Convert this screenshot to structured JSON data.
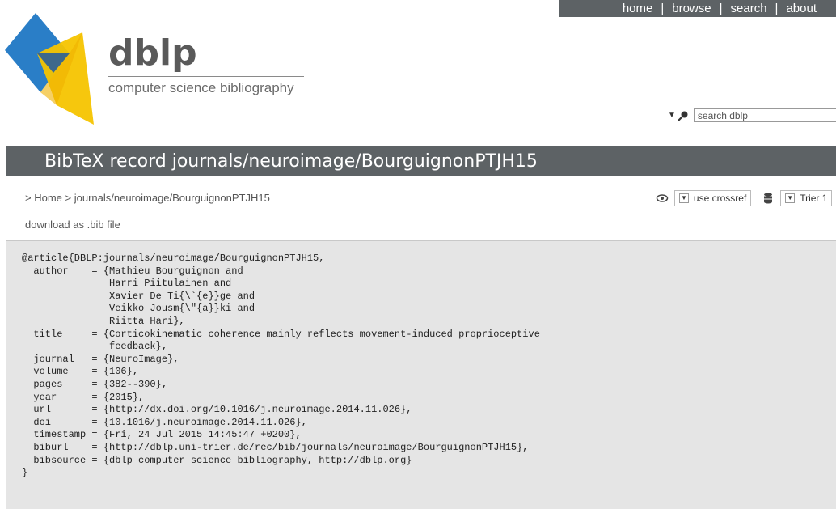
{
  "nav": {
    "items": [
      "home",
      "browse",
      "search",
      "about"
    ],
    "separator": "|"
  },
  "brand": {
    "name": "dblp",
    "subtitle": "computer science bibliography"
  },
  "search": {
    "placeholder": "search dblp"
  },
  "title": "BibTeX record journals/neuroimage/BourguignonPTJH15",
  "breadcrumb": {
    "prefix": "> ",
    "home": "Home",
    "sep": " > ",
    "current": "journals/neuroimage/BourguignonPTJH15"
  },
  "controls": {
    "crossref_label": "use crossref",
    "server_label": "Trier 1"
  },
  "download_label": "download as .bib file",
  "bibtex": "@article{DBLP:journals/neuroimage/BourguignonPTJH15,\n  author    = {Mathieu Bourguignon and\n               Harri Piitulainen and\n               Xavier De Ti{\\`{e}}ge and\n               Veikko Jousm{\\\"{a}}ki and\n               Riitta Hari},\n  title     = {Corticokinematic coherence mainly reflects movement-induced proprioceptive\n               feedback},\n  journal   = {NeuroImage},\n  volume    = {106},\n  pages     = {382--390},\n  year      = {2015},\n  url       = {http://dx.doi.org/10.1016/j.neuroimage.2014.11.026},\n  doi       = {10.1016/j.neuroimage.2014.11.026},\n  timestamp = {Fri, 24 Jul 2015 14:45:47 +0200},\n  biburl    = {http://dblp.uni-trier.de/rec/bib/journals/neuroimage/BourguignonPTJH15},\n  bibsource = {dblp computer science bibliography, http://dblp.org}\n}",
  "colors": {
    "bar": "#5d6265",
    "logo_blue": "#1f77c4",
    "logo_yellow": "#f5c400",
    "bib_bg": "#e5e5e5"
  },
  "icons": {
    "search": "search-icon",
    "view": "eye-icon",
    "server": "database-icon"
  }
}
